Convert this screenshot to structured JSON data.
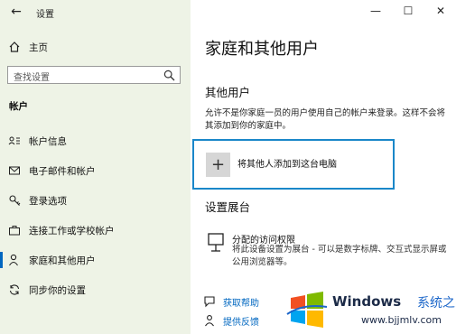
{
  "app": {
    "title": "设置"
  },
  "sidebar": {
    "home_label": "主页",
    "search_placeholder": "查找设置",
    "section_header": "帐户",
    "items": [
      {
        "label": "帐户信息",
        "icon": "account-info-icon"
      },
      {
        "label": "电子邮件和帐户",
        "icon": "email-icon"
      },
      {
        "label": "登录选项",
        "icon": "key-icon"
      },
      {
        "label": "连接工作或学校帐户",
        "icon": "briefcase-icon"
      },
      {
        "label": "家庭和其他用户",
        "icon": "person-icon",
        "active": true
      },
      {
        "label": "同步你的设置",
        "icon": "sync-icon"
      }
    ]
  },
  "window_controls": {
    "minimize": "—",
    "maximize": "☐",
    "close": "✕"
  },
  "main": {
    "title": "家庭和其他用户",
    "other_users": {
      "title": "其他用户",
      "description": "允许不是你家庭一员的用户使用自己的帐户来登录。这样不会将其添加到你的家庭中。",
      "add_label": "将其他人添加到这台电脑"
    },
    "kiosk": {
      "title": "设置展台",
      "item_title": "分配的访问权限",
      "item_description": "将此设备设置为展台 - 可以是数字标牌、交互式显示屏或公用浏览器等。"
    },
    "help": {
      "get_help": "获取帮助",
      "feedback": "提供反馈"
    }
  },
  "watermark": {
    "brand": "Windows",
    "cn": "系统之家",
    "url": "www.bjjmlv.com"
  },
  "colors": {
    "sidebar_bg": "#eef3e6",
    "accent": "#0067c0",
    "focus_border": "#1a87c9"
  }
}
